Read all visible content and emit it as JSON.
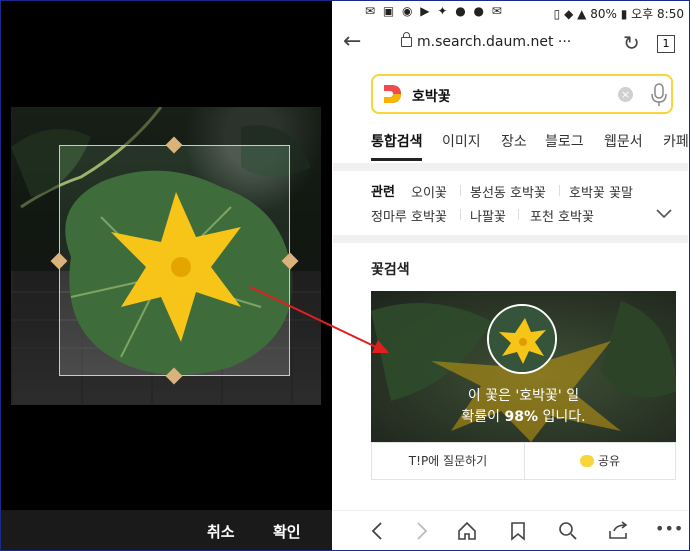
{
  "crop_screen": {
    "cancel_label": "취소",
    "confirm_label": "확인"
  },
  "status_bar": {
    "battery": "80%",
    "time": "오후 8:50"
  },
  "address_bar": {
    "url": "m.search.daum.net",
    "more": "···",
    "tab_count": "1"
  },
  "search": {
    "query": "호박꽃"
  },
  "nav_tabs": [
    "통합검색",
    "이미지",
    "장소",
    "블로그",
    "웹문서",
    "카페"
  ],
  "related": {
    "label": "관련",
    "items": [
      "오이꽃",
      "봉선동 호박꽃",
      "호박꽃 꽃말",
      "정마루 호박꽃",
      "나팔꽃",
      "포천 호박꽃"
    ]
  },
  "flower_search": {
    "title": "꽃검색",
    "result_line1": "이 꽃은 '호박꽃' 일",
    "result_line2_prefix": "확률이 ",
    "probability": "98%",
    "result_line2_suffix": " 입니다.",
    "ask_tip_label": "T!P에 질문하기",
    "share_label": "공유"
  },
  "colors": {
    "accent_yellow": "#f7d53b",
    "arrow_red": "#e02020",
    "crop_handle": "#d9b27c"
  }
}
